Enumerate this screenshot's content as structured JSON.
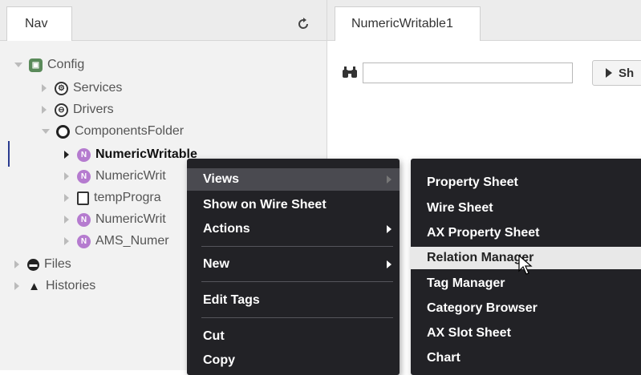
{
  "nav": {
    "tab_label": "Nav",
    "tree": {
      "config": "Config",
      "services": "Services",
      "drivers": "Drivers",
      "components_folder": "ComponentsFolder",
      "numeric_writable": "NumericWritable",
      "numeric_writable_2": "NumericWrit",
      "temp_program": "tempProgra",
      "numeric_writable_3": "NumericWrit",
      "ams_numeric": "AMS_Numer",
      "files": "Files",
      "histories": "Histories"
    }
  },
  "content": {
    "tab_label": "NumericWritable1",
    "search": {
      "value": "",
      "placeholder": ""
    },
    "show_button_label": "Sh"
  },
  "context_menu": {
    "items": [
      {
        "label": "Views",
        "has_submenu": true
      },
      {
        "label": "Show on Wire Sheet"
      },
      {
        "label": "Actions",
        "has_submenu": true
      },
      {
        "label": "New",
        "has_submenu": true
      },
      {
        "label": "Edit Tags"
      },
      {
        "label": "Cut"
      },
      {
        "label": "Copy"
      }
    ]
  },
  "views_submenu": {
    "items": [
      {
        "label": "Property Sheet"
      },
      {
        "label": "Wire Sheet"
      },
      {
        "label": "AX Property Sheet"
      },
      {
        "label": "Relation Manager"
      },
      {
        "label": "Tag Manager"
      },
      {
        "label": "Category Browser"
      },
      {
        "label": "AX Slot Sheet"
      },
      {
        "label": "Chart"
      }
    ]
  },
  "colors": {
    "menu_bg": "#222226",
    "node_icon_purple": "#b57bcf",
    "highlight_light": "#e8e8e8"
  }
}
